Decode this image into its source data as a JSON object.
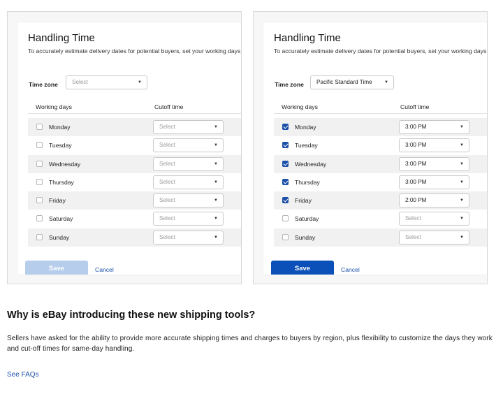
{
  "left_card": {
    "title": "Handling Time",
    "description": "To accurately estimate delivery dates for potential buyers, set your working days and",
    "timezone_label": "Time zone",
    "timezone_value": "Select",
    "col_working_days": "Working days",
    "col_cutoff_time": "Cutoff time",
    "rows": [
      {
        "day": "Monday",
        "checked": false,
        "cutoff": "Select"
      },
      {
        "day": "Tuesday",
        "checked": false,
        "cutoff": "Select"
      },
      {
        "day": "Wednesday",
        "checked": false,
        "cutoff": "Select"
      },
      {
        "day": "Thursday",
        "checked": false,
        "cutoff": "Select"
      },
      {
        "day": "Friday",
        "checked": false,
        "cutoff": "Select"
      },
      {
        "day": "Saturday",
        "checked": false,
        "cutoff": "Select"
      },
      {
        "day": "Sunday",
        "checked": false,
        "cutoff": "Select"
      }
    ],
    "save_label": "Save",
    "save_state": "disabled",
    "cancel_label": "Cancel"
  },
  "right_card": {
    "title": "Handling Time",
    "description": "To accurately estimate delivery dates for potential buyers, set your working days and",
    "timezone_label": "Time zone",
    "timezone_value": "Pacific Standard Time",
    "col_working_days": "Working days",
    "col_cutoff_time": "Cutoff time",
    "rows": [
      {
        "day": "Monday",
        "checked": true,
        "cutoff": "3:00 PM"
      },
      {
        "day": "Tuesday",
        "checked": true,
        "cutoff": "3:00 PM"
      },
      {
        "day": "Wednesday",
        "checked": true,
        "cutoff": "3:00 PM"
      },
      {
        "day": "Thursday",
        "checked": true,
        "cutoff": "3:00 PM"
      },
      {
        "day": "Friday",
        "checked": true,
        "cutoff": "2:00 PM"
      },
      {
        "day": "Saturday",
        "checked": false,
        "cutoff": "Select"
      },
      {
        "day": "Sunday",
        "checked": false,
        "cutoff": "Select"
      }
    ],
    "save_label": "Save",
    "save_state": "enabled",
    "cancel_label": "Cancel"
  },
  "icons": {
    "dropdown": "caret-down-icon",
    "checkbox_checked": "checkmark-icon"
  },
  "colors": {
    "primary_blue": "#0b4fb8",
    "disabled_blue": "#b6cdeb",
    "link_blue": "#1b4fa8",
    "row_shade": "#f1f1f1"
  },
  "article": {
    "heading": "Why is eBay introducing these new shipping tools?",
    "body": "Sellers have asked for the ability to provide more accurate shipping times and charges to buyers by region, plus flexibility to customize the days they work and cut-off times for same-day handling.",
    "faq_link": "See FAQs"
  }
}
